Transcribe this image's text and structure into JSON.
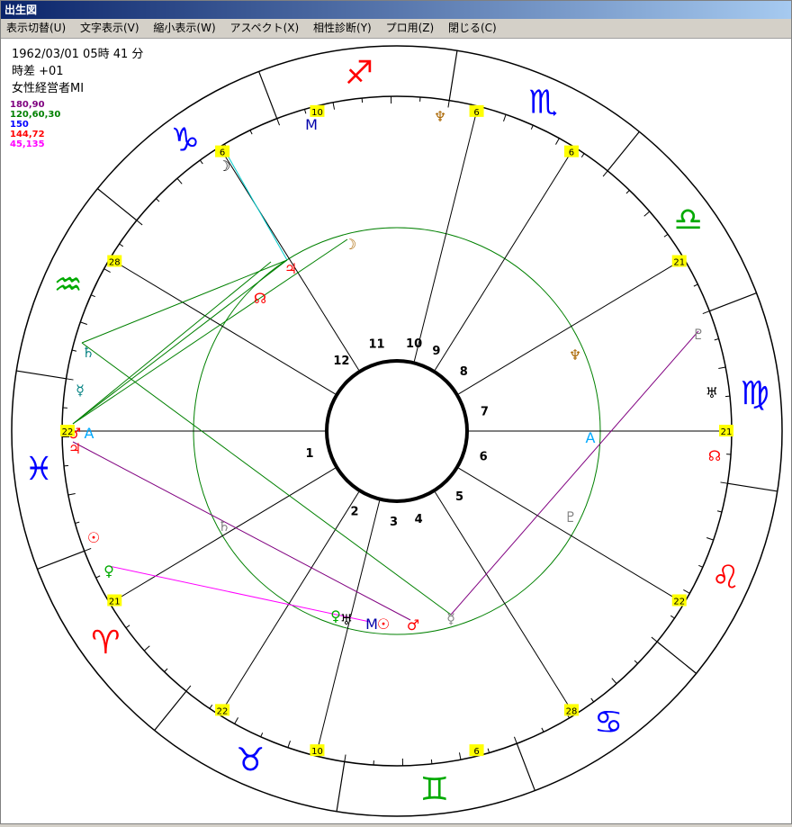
{
  "window": {
    "title": "出生図"
  },
  "menu": [
    "表示切替(U)",
    "文字表示(V)",
    "縮小表示(W)",
    "アスペクト(X)",
    "相性診断(Y)",
    "プロ用(Z)",
    "閉じる(C)"
  ],
  "info": {
    "datetime": "1962/03/01 05時 41 分",
    "timediff": "時差 +01",
    "name": "女性経営者MI"
  },
  "legend": [
    {
      "label": "180,90",
      "color": "#800080"
    },
    {
      "label": "120,60,30",
      "color": "#008000"
    },
    {
      "label": "150",
      "color": "#0000ff"
    },
    {
      "label": "144,72",
      "color": "#ff0000"
    },
    {
      "label": "45,135",
      "color": "#ff00ff"
    }
  ],
  "chart": {
    "house_numbers": [
      "1",
      "2",
      "3",
      "4",
      "5",
      "6",
      "7",
      "8",
      "9",
      "10",
      "11",
      "12"
    ],
    "sign_glyphs": [
      "♏",
      "♎",
      "♍",
      "♌",
      "♋",
      "♊",
      "♉",
      "♈",
      "♓",
      "♒",
      "♑",
      "♐"
    ],
    "sign_colors": [
      "#0000ff",
      "#00aa00",
      "#0000ff",
      "#ff0000",
      "#0000ff",
      "#00aa00",
      "#0000ff",
      "#ff0000",
      "#0000ff",
      "#00aa00",
      "#0000ff",
      "#ff0000"
    ],
    "cusp_degrees": [
      "10",
      "6",
      "21",
      "22",
      "28",
      "6",
      "10",
      "6",
      "28",
      "22",
      "21",
      "6"
    ],
    "planet_glyphs": {
      "sun": "☉",
      "moon": "☽",
      "mercury": "☿",
      "venus": "♀",
      "mars": "♂",
      "jupiter": "♃",
      "saturn": "♄",
      "uranus": "♅",
      "neptune": "♆",
      "pluto": "♇",
      "node": "☊",
      "asc": "A",
      "mc": "M"
    }
  }
}
